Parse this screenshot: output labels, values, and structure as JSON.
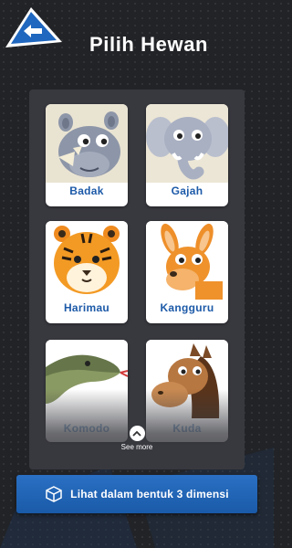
{
  "header": {
    "title": "Pilih Hewan",
    "back_icon": "arrow-left-icon"
  },
  "animals": [
    {
      "name": "Badak",
      "icon": "rhinoceros"
    },
    {
      "name": "Gajah",
      "icon": "elephant"
    },
    {
      "name": "Harimau",
      "icon": "tiger"
    },
    {
      "name": "Kangguru",
      "icon": "kangaroo"
    },
    {
      "name": "Komodo",
      "icon": "komodo-dragon"
    },
    {
      "name": "Kuda",
      "icon": "horse"
    }
  ],
  "see_more": {
    "label": "See more",
    "icon": "chevron-up-icon"
  },
  "cta": {
    "label": "Lihat dalam bentuk 3 dimensi",
    "icon": "cube-icon"
  },
  "colors": {
    "background": "#222327",
    "panel": "#38393f",
    "accent_blue": "#1d5aa8",
    "card": "#ffffff"
  }
}
